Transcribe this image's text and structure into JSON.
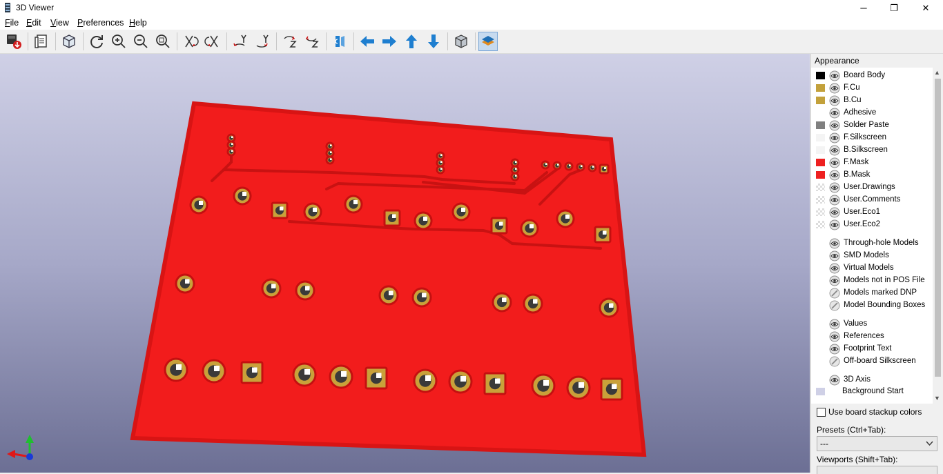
{
  "window": {
    "title": "3D Viewer",
    "controls": {
      "minimize": "─",
      "restore": "❐",
      "close": "✕"
    }
  },
  "menubar": {
    "items": [
      {
        "label": "File",
        "mnemonic": "F"
      },
      {
        "label": "Edit",
        "mnemonic": "E"
      },
      {
        "label": "View",
        "mnemonic": "V"
      },
      {
        "label": "Preferences",
        "mnemonic": "P"
      },
      {
        "label": "Help",
        "mnemonic": "H"
      }
    ]
  },
  "toolbar": {
    "buttons": [
      "export-image",
      "copy-to-clipboard",
      "render-options",
      "reload-board",
      "zoom-in",
      "zoom-out",
      "zoom-fit",
      "rotate-x-cw",
      "rotate-x-ccw",
      "rotate-y-cw",
      "rotate-y-ccw",
      "rotate-z-cw",
      "rotate-z-ccw",
      "flip-board",
      "pan-left",
      "pan-right",
      "pan-up",
      "pan-down",
      "toggle-orthographic",
      "toggle-appearance-panel"
    ],
    "active_button": "toggle-appearance-panel"
  },
  "colors": {
    "board_red": "#f21c1c",
    "board_edge": "#e21414",
    "copper": "#c9a13a",
    "accent_blue": "#1f7fd0",
    "viewport_top": "#cfd0e6",
    "viewport_bottom": "#6c6f94"
  },
  "appearance": {
    "title": "Appearance",
    "layers": [
      {
        "label": "Board Body",
        "swatch": "#000000",
        "eye": "visible"
      },
      {
        "label": "F.Cu",
        "swatch": "#c3a13b",
        "eye": "visible"
      },
      {
        "label": "B.Cu",
        "swatch": "#c3a13b",
        "eye": "visible"
      },
      {
        "label": "Adhesive",
        "swatch": "",
        "eye": "visible"
      },
      {
        "label": "Solder Paste",
        "swatch": "#808080",
        "eye": "visible"
      },
      {
        "label": "F.Silkscreen",
        "swatch": "#f4f4f4",
        "eye": "visible"
      },
      {
        "label": "B.Silkscreen",
        "swatch": "#f4f4f4",
        "eye": "visible"
      },
      {
        "label": "F.Mask",
        "swatch": "#ee2020",
        "eye": "visible"
      },
      {
        "label": "B.Mask",
        "swatch": "#ee2020",
        "eye": "visible"
      },
      {
        "label": "User.Drawings",
        "swatch": "checker",
        "eye": "visible"
      },
      {
        "label": "User.Comments",
        "swatch": "checker",
        "eye": "visible"
      },
      {
        "label": "User.Eco1",
        "swatch": "checker",
        "eye": "visible"
      },
      {
        "label": "User.Eco2",
        "swatch": "checker",
        "eye": "visible"
      }
    ],
    "models": [
      {
        "label": "Through-hole Models",
        "eye": "visible"
      },
      {
        "label": "SMD Models",
        "eye": "visible"
      },
      {
        "label": "Virtual Models",
        "eye": "visible"
      },
      {
        "label": "Models not in POS File",
        "eye": "visible"
      },
      {
        "label": "Models marked DNP",
        "eye": "hidden"
      },
      {
        "label": "Model Bounding Boxes",
        "eye": "hidden"
      }
    ],
    "text_items": [
      {
        "label": "Values",
        "eye": "visible"
      },
      {
        "label": "References",
        "eye": "visible"
      },
      {
        "label": "Footprint Text",
        "eye": "visible"
      },
      {
        "label": "Off-board Silkscreen",
        "eye": "hidden"
      }
    ],
    "misc": [
      {
        "label": "3D Axis",
        "eye": "visible"
      },
      {
        "label": "Background Start",
        "swatch": "#cfd0e6"
      }
    ],
    "use_stackup_colors": {
      "label": "Use board stackup colors",
      "checked": false
    },
    "presets": {
      "label": "Presets (Ctrl+Tab):",
      "value": "---"
    },
    "viewports": {
      "label": "Viewports (Shift+Tab):"
    }
  }
}
